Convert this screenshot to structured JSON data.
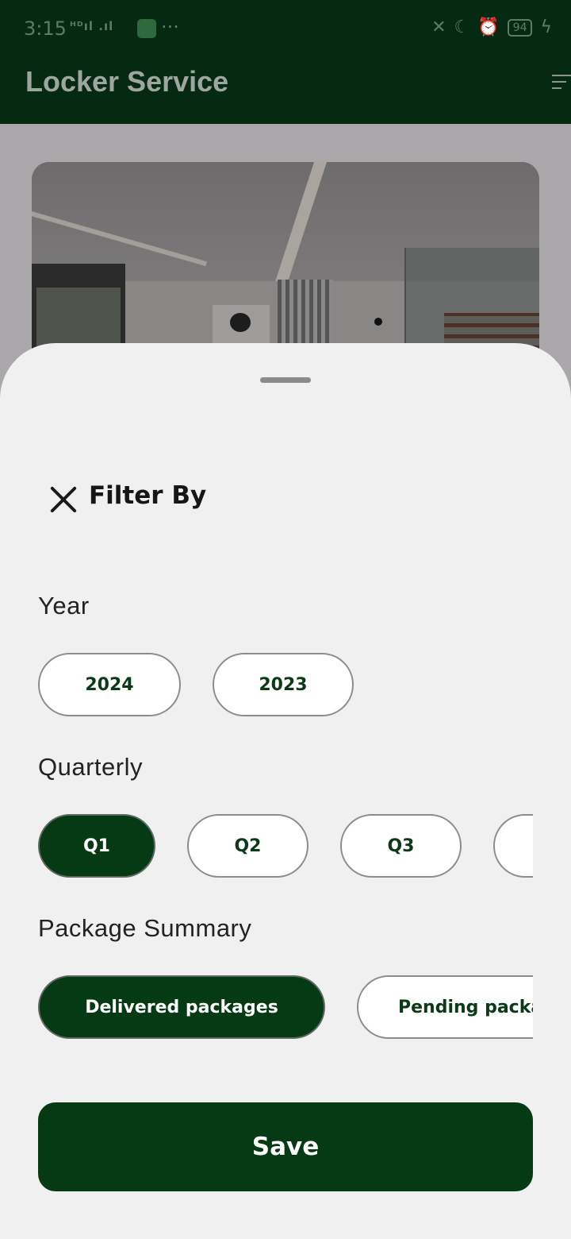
{
  "status_bar": {
    "time": "3:15",
    "signal": "ᴴᴰıl .ıl",
    "overflow": "···",
    "battery": "94",
    "icons": [
      "vibrate-off-icon",
      "moon-icon",
      "alarm-icon",
      "battery-icon",
      "charging-icon"
    ]
  },
  "app_bar": {
    "title": "Locker Service",
    "menu_icon": "filter-list-icon"
  },
  "sheet": {
    "title": "Filter By",
    "close_icon": "close-icon",
    "year": {
      "label": "Year",
      "options": [
        {
          "label": "2024",
          "selected": false
        },
        {
          "label": "2023",
          "selected": false
        }
      ]
    },
    "quarterly": {
      "label": "Quarterly",
      "options": [
        {
          "label": "Q1",
          "selected": true
        },
        {
          "label": "Q2",
          "selected": false
        },
        {
          "label": "Q3",
          "selected": false
        },
        {
          "label": "",
          "selected": false
        }
      ]
    },
    "package_summary": {
      "label": "Package Summary",
      "options": [
        {
          "label": "Delivered packages",
          "selected": true
        },
        {
          "label": "Pending packages",
          "selected": false
        }
      ]
    },
    "save_label": "Save"
  },
  "colors": {
    "primary": "#063a15",
    "app_bar": "#052a11",
    "sheet_bg": "#f0f0f0",
    "chip_border": "#8c8c8c",
    "scrim": "#a9a7a9"
  }
}
